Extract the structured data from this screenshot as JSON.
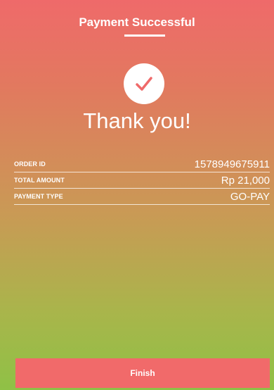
{
  "header": {
    "title": "Payment Successful"
  },
  "status": {
    "icon": "check-icon",
    "message": "Thank you!"
  },
  "details": [
    {
      "label": "ORDER ID",
      "value": "1578949675911"
    },
    {
      "label": "TOTAL AMOUNT",
      "value": "Rp 21,000"
    },
    {
      "label": "PAYMENT TYPE",
      "value": "GO-PAY"
    }
  ],
  "actions": {
    "finish_label": "Finish"
  },
  "colors": {
    "gradient_top": "#ef6a6a",
    "gradient_bottom": "#8fc146",
    "button": "#f16a6a",
    "check": "#ef6a6a"
  }
}
